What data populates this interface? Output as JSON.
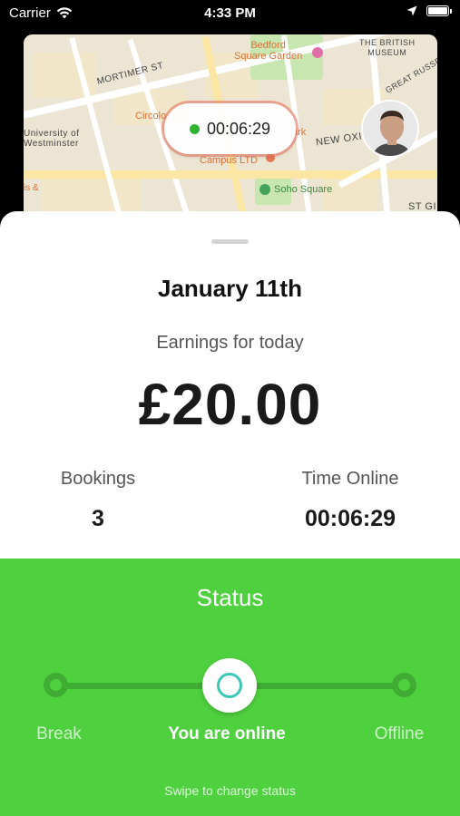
{
  "status_bar": {
    "carrier": "Carrier",
    "time": "4:33 PM",
    "icons": [
      "wifi-icon",
      "location-arrow-icon",
      "battery-icon"
    ]
  },
  "map": {
    "labels": {
      "mortimer": "MORTIMER ST",
      "bedford": "Bedford\nSquare Garden",
      "british": "THE BRITISH\nMUSEUM",
      "great": "GREAT RUSSE",
      "circolo": "Circolo",
      "university": "University of\nWestminster",
      "park": "ark",
      "newox": "NEW OXI",
      "campus": "Campus LTD",
      "soho": "Soho Square",
      "stg": "ST GI",
      "is": "is &"
    },
    "timer": "00:06:29",
    "online_dot_color": "#2fb52f"
  },
  "sheet": {
    "date": "January 11th",
    "earnings_label": "Earnings for today",
    "earnings_amount": "£20.00",
    "bookings_label": "Bookings",
    "bookings_value": "3",
    "time_online_label": "Time Online",
    "time_online_value": "00:06:29"
  },
  "status_panel": {
    "title": "Status",
    "options": [
      "Break",
      "You are online",
      "Offline"
    ],
    "selected": "You are online",
    "hint": "Swipe to change status",
    "background_color": "#4fd13f",
    "knob_ring_color": "#3dc7b6"
  }
}
